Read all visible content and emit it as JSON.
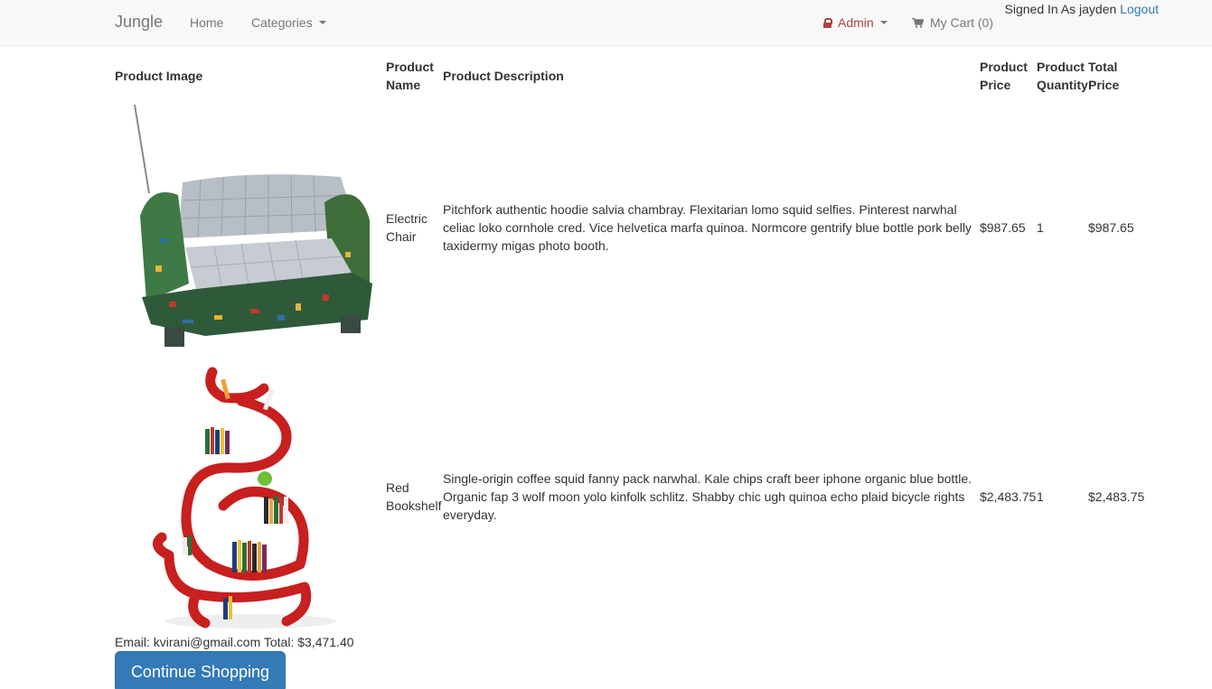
{
  "navbar": {
    "brand": "Jungle",
    "home": "Home",
    "categories": "Categories",
    "admin": "Admin",
    "cart": "My Cart (0)",
    "signed_in_text": "Signed In As jayden",
    "logout": "Logout"
  },
  "table": {
    "headers": {
      "image": "Product Image",
      "name": "Product Name",
      "description": "Product Description",
      "price": "Product Price",
      "quantity": "Product Quantity",
      "total": "Total Price"
    },
    "rows": [
      {
        "name": "Electric Chair",
        "description": "Pitchfork authentic hoodie salvia chambray. Flexitarian lomo squid selfies. Pinterest narwhal celiac loko cornhole cred. Vice helvetica marfa quinoa. Normcore gentrify blue bottle pork belly taxidermy migas photo booth.",
        "price": "$987.65",
        "quantity": "1",
        "total": "$987.65"
      },
      {
        "name": "Red Bookshelf",
        "description": "Single-origin coffee squid fanny pack narwhal. Kale chips craft beer iphone organic blue bottle. Organic fap 3 wolf moon yolo kinfolk schlitz. Shabby chic ugh quinoa echo plaid bicycle rights everyday.",
        "price": "$2,483.75",
        "quantity": "1",
        "total": "$2,483.75"
      }
    ]
  },
  "summary": {
    "text": "Email: kvirani@gmail.com Total: $3,471.40"
  },
  "continue_button": "Continue Shopping",
  "colors": {
    "primary": "#337ab7",
    "admin": "#a94442",
    "navbar_bg": "#f8f8f8"
  }
}
